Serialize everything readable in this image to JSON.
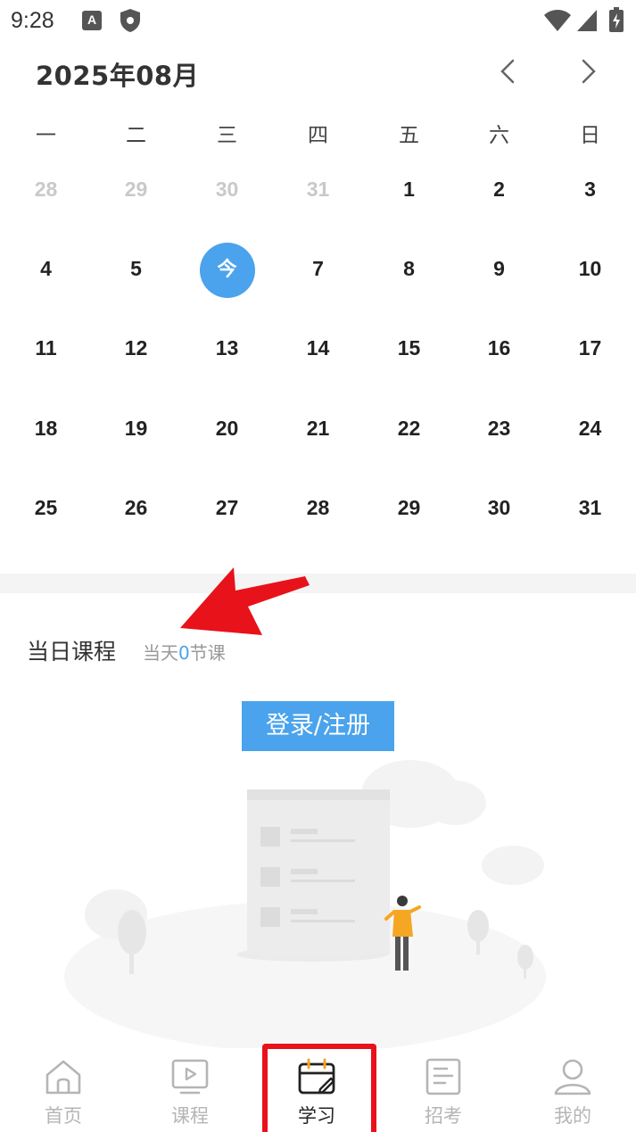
{
  "status_bar": {
    "time": "9:28",
    "icons": [
      "a-notification-icon",
      "shield-icon",
      "wifi-icon",
      "signal-icon",
      "battery-charging-icon"
    ]
  },
  "calendar": {
    "title": "2025年08月",
    "prev_icon": "chevron-left-icon",
    "next_icon": "chevron-right-icon",
    "weekdays": [
      "一",
      "二",
      "三",
      "四",
      "五",
      "六",
      "日"
    ],
    "weeks": [
      [
        {
          "label": "28",
          "muted": true
        },
        {
          "label": "29",
          "muted": true
        },
        {
          "label": "30",
          "muted": true
        },
        {
          "label": "31",
          "muted": true
        },
        {
          "label": "1"
        },
        {
          "label": "2"
        },
        {
          "label": "3"
        }
      ],
      [
        {
          "label": "4"
        },
        {
          "label": "5"
        },
        {
          "label": "今",
          "today": true
        },
        {
          "label": "7"
        },
        {
          "label": "8"
        },
        {
          "label": "9"
        },
        {
          "label": "10"
        }
      ],
      [
        {
          "label": "11"
        },
        {
          "label": "12"
        },
        {
          "label": "13"
        },
        {
          "label": "14"
        },
        {
          "label": "15"
        },
        {
          "label": "16"
        },
        {
          "label": "17"
        }
      ],
      [
        {
          "label": "18"
        },
        {
          "label": "19"
        },
        {
          "label": "20"
        },
        {
          "label": "21"
        },
        {
          "label": "22"
        },
        {
          "label": "23"
        },
        {
          "label": "24"
        }
      ],
      [
        {
          "label": "25"
        },
        {
          "label": "26"
        },
        {
          "label": "27"
        },
        {
          "label": "28"
        },
        {
          "label": "29"
        },
        {
          "label": "30"
        },
        {
          "label": "31"
        }
      ]
    ],
    "today_color": "#4aa3ec"
  },
  "daily_courses": {
    "title": "当日课程",
    "sub_prefix": "当天",
    "count": "0",
    "sub_suffix": "节课",
    "login_button": "登录/注册"
  },
  "annotation": {
    "arrow_color": "#e8121b",
    "highlight_color": "#e8121b"
  },
  "tab_bar": {
    "tabs": [
      {
        "label": "首页",
        "icon": "home-icon",
        "active": false
      },
      {
        "label": "课程",
        "icon": "video-play-icon",
        "active": false
      },
      {
        "label": "学习",
        "icon": "calendar-edit-icon",
        "active": true
      },
      {
        "label": "招考",
        "icon": "document-icon",
        "active": false
      },
      {
        "label": "我的",
        "icon": "user-icon",
        "active": false
      }
    ]
  },
  "colors": {
    "accent": "#4aa3ec",
    "inactive_tab": "#b5b5b5",
    "muted_day": "#c9c9c9"
  }
}
